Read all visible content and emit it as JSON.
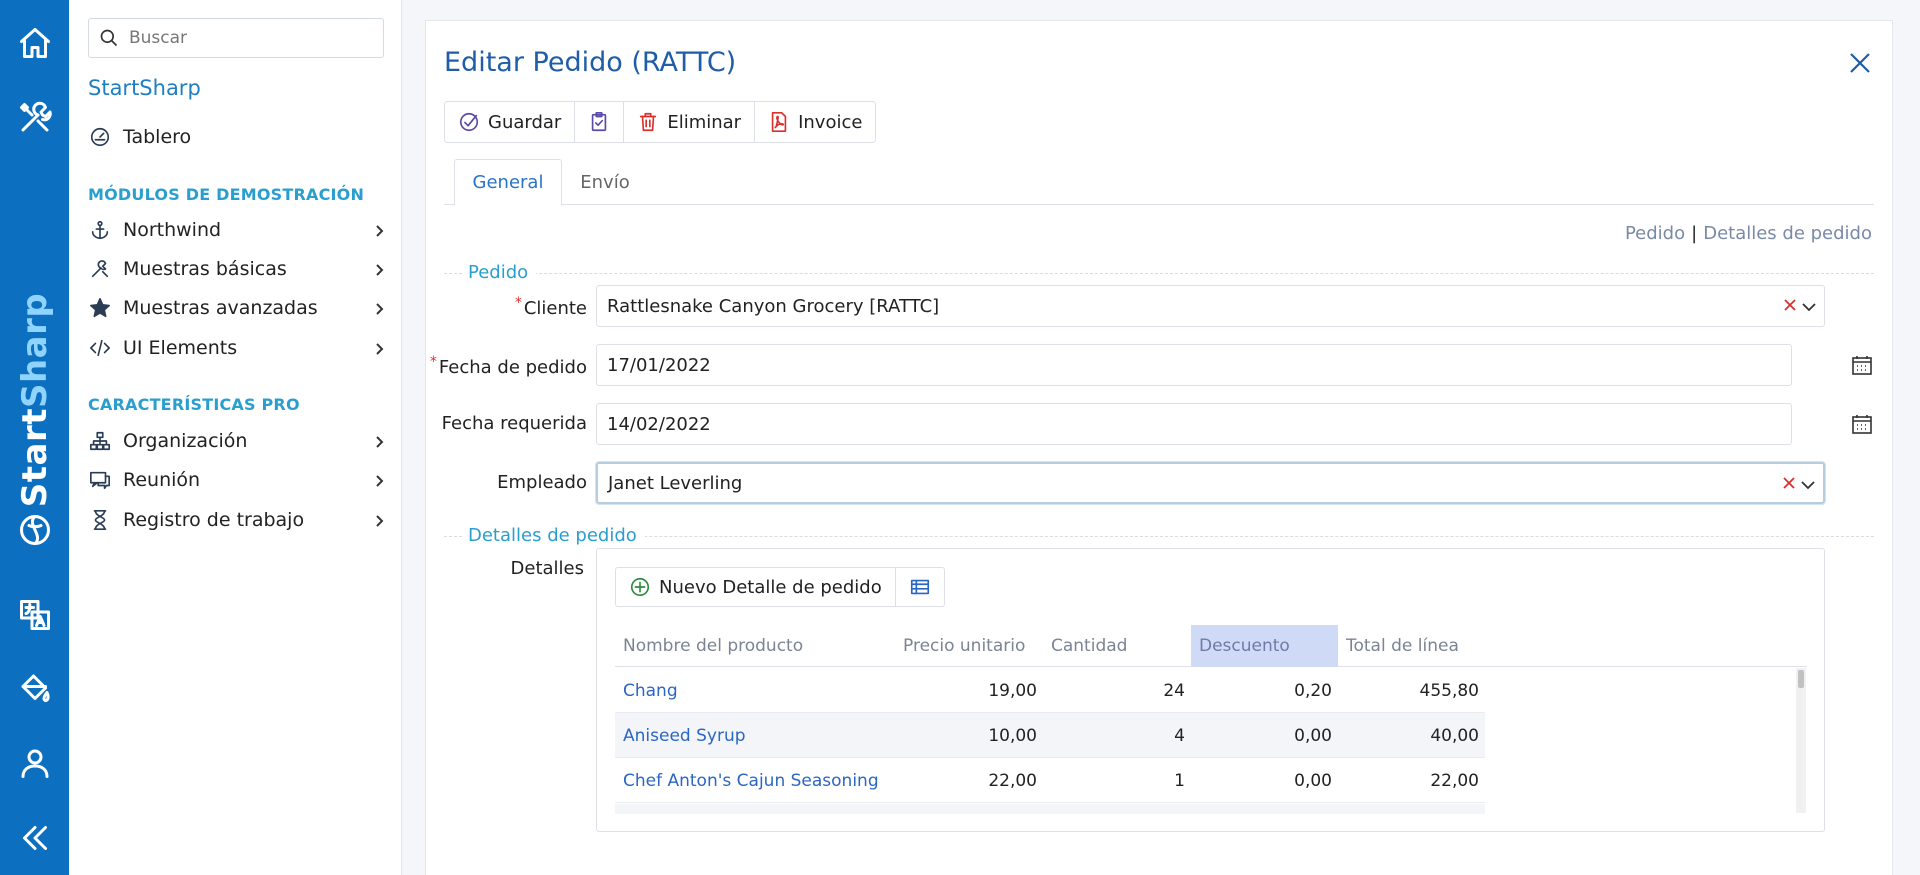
{
  "sidebar": {
    "search_placeholder": "Buscar",
    "brand": "StartSharp",
    "tablero": "Tablero",
    "section_demo": "MÓDULOS DE DEMOSTRACIÓN",
    "demo_items": [
      {
        "label": "Northwind",
        "icon": "anchor-icon"
      },
      {
        "label": "Muestras básicas",
        "icon": "tools-icon"
      },
      {
        "label": "Muestras avanzadas",
        "icon": "star-icon"
      },
      {
        "label": "UI Elements",
        "icon": "code-icon"
      }
    ],
    "section_pro": "CARACTERÍSTICAS PRO",
    "pro_items": [
      {
        "label": "Organización",
        "icon": "sitemap-icon"
      },
      {
        "label": "Reunión",
        "icon": "meeting-icon"
      },
      {
        "label": "Registro de trabajo",
        "icon": "hourglass-icon"
      }
    ]
  },
  "rail": {
    "brand_start": "Start",
    "brand_sharp": "Sharp"
  },
  "dialog": {
    "title": "Editar Pedido (RATTC)",
    "toolbar": {
      "save": "Guardar",
      "delete": "Eliminar",
      "invoice": "Invoice"
    },
    "tabs": [
      "General",
      "Envío"
    ],
    "crumb": {
      "a": "Pedido",
      "sep": "|",
      "b": "Detalles de pedido"
    },
    "cat_order": "Pedido",
    "cat_details": "Detalles de pedido",
    "fields": {
      "cliente_label": "Cliente",
      "cliente_value": "Rattlesnake Canyon Grocery [RATTC]",
      "fecha_pedido_label": "Fecha de pedido",
      "fecha_pedido_value": "17/01/2022",
      "fecha_req_label": "Fecha requerida",
      "fecha_req_value": "14/02/2022",
      "empleado_label": "Empleado",
      "empleado_value": "Janet Leverling",
      "detalles_label": "Detalles",
      "required_mark": "*"
    },
    "grid": {
      "new_button": "Nuevo Detalle de pedido",
      "headers": [
        "Nombre del producto",
        "Precio unitario",
        "Cantidad",
        "Descuento",
        "Total de línea"
      ],
      "rows": [
        {
          "product": "Chang",
          "price": "19,00",
          "qty": "24",
          "discount": "0,20",
          "total": "455,80"
        },
        {
          "product": "Aniseed Syrup",
          "price": "10,00",
          "qty": "4",
          "discount": "0,00",
          "total": "40,00"
        },
        {
          "product": "Chef Anton's Cajun Seasoning",
          "price": "22,00",
          "qty": "1",
          "discount": "0,00",
          "total": "22,00"
        }
      ]
    }
  },
  "colors": {
    "rail": "#0d6fbf",
    "title": "#1f5da6",
    "section": "#2a9fcf",
    "link": "#2a66c2",
    "required": "#d9302c",
    "sorted_header": "#cfdbf6"
  }
}
